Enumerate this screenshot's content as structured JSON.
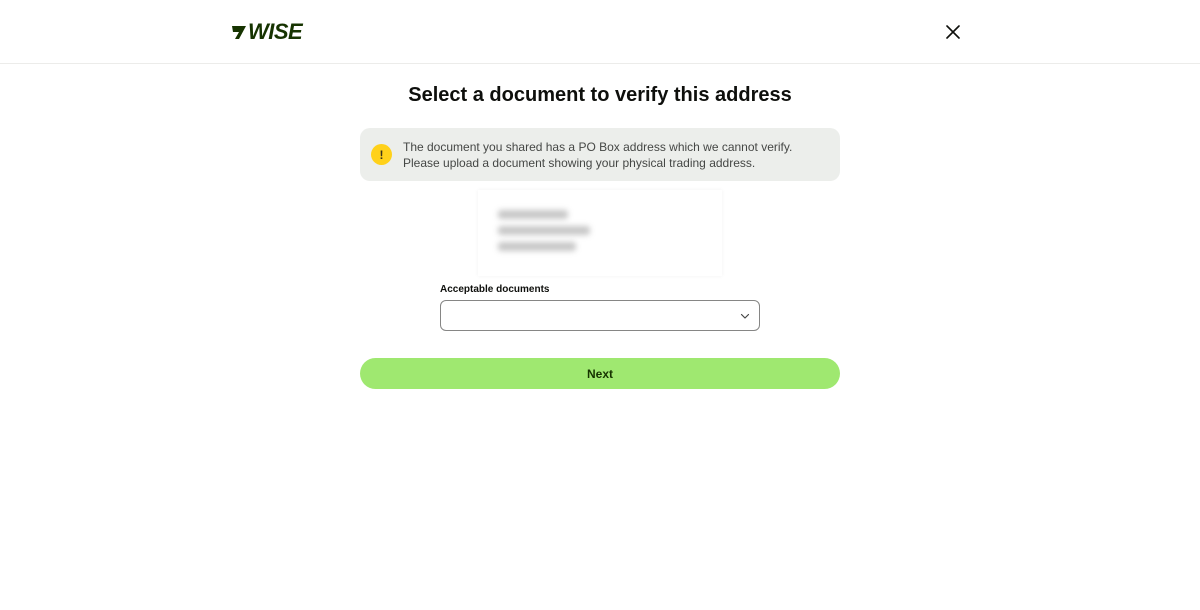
{
  "header": {
    "logo_text": "WISE",
    "brand_color": "#163300",
    "close_icon": "close-icon"
  },
  "main": {
    "title": "Select a document to verify this address",
    "alert": {
      "icon": "warning-icon",
      "icon_glyph": "!",
      "icon_color": "#ffd11a",
      "message": "The document you shared has a PO Box address which we cannot verify. Please upload a document showing your physical trading address."
    },
    "document_field": {
      "label": "Acceptable documents",
      "value": "",
      "chevron_icon": "chevron-down-icon"
    },
    "next_button": {
      "label": "Next",
      "color": "#9fe870"
    }
  }
}
